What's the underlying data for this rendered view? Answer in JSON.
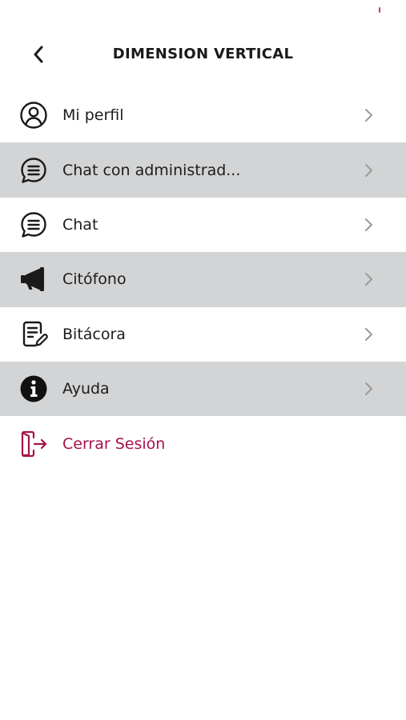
{
  "header": {
    "title": "DIMENSION VERTICAL",
    "back_icon": "chevron-left-icon"
  },
  "menu": {
    "items": [
      {
        "label": "Mi perfil",
        "icon": "user-circle-icon",
        "shaded": false
      },
      {
        "label": "Chat con administrad...",
        "icon": "chat-bubble-icon",
        "shaded": true
      },
      {
        "label": "Chat",
        "icon": "chat-bubble-icon",
        "shaded": false
      },
      {
        "label": "Citófono",
        "icon": "megaphone-icon",
        "shaded": true
      },
      {
        "label": "Bitácora",
        "icon": "logbook-edit-icon",
        "shaded": false
      },
      {
        "label": "Ayuda",
        "icon": "info-icon",
        "shaded": true
      }
    ],
    "logout": {
      "label": "Cerrar Sesión",
      "icon": "logout-door-icon"
    }
  },
  "colors": {
    "shaded_row": "#d3d4d5",
    "logout_accent": "#a6124a",
    "chevron": "#9a9a9a",
    "status_mark": "#e0344a"
  }
}
